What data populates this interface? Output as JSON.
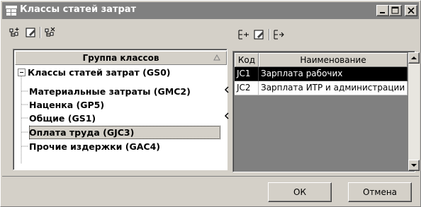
{
  "window": {
    "title": "Классы статей затрат"
  },
  "tree": {
    "header": "Группа классов",
    "root": "Классы статей затрат (GS0)",
    "items": [
      "Материальные затраты (GMC2)",
      "Наценка (GP5)",
      "Общие (GS1)",
      "Оплата труда (GJC3)",
      "Прочие издержки (GAC4)"
    ],
    "selected_index": 3
  },
  "grid": {
    "columns": [
      "Код",
      "Наименование"
    ],
    "rows": [
      {
        "code": "JC1",
        "name": "Зарплата рабочих"
      },
      {
        "code": "JC2",
        "name": "Зарплата ИТР и администрации"
      }
    ],
    "selected_index": 0
  },
  "buttons": {
    "ok": "ОК",
    "cancel": "Отмена"
  },
  "icons": {
    "left_toolbar": [
      "add-class-icon",
      "edit-class-icon",
      "delete-class-icon"
    ],
    "right_toolbar": [
      "add-item-icon",
      "edit-item-icon",
      "move-item-icon"
    ],
    "title_buttons": [
      "minimize-icon",
      "maximize-icon",
      "close-icon"
    ]
  }
}
